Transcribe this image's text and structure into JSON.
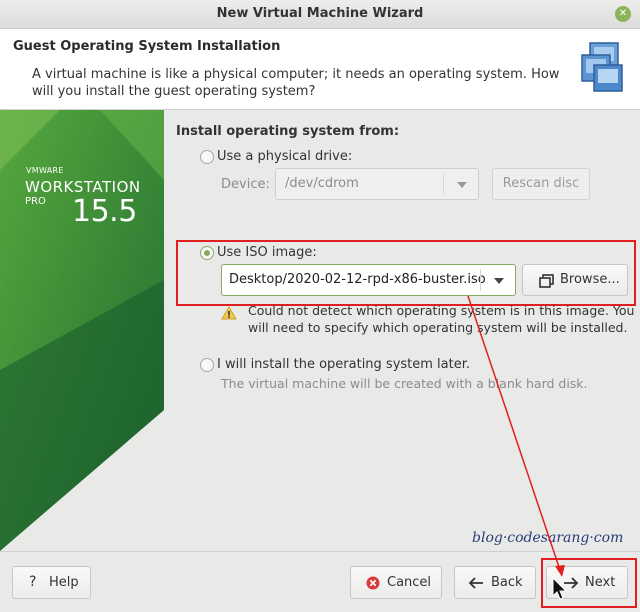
{
  "window": {
    "title": "New Virtual Machine Wizard"
  },
  "header": {
    "title": "Guest Operating System Installation",
    "description": "A virtual machine is like a physical computer; it needs an operating system. How will you install the guest operating system?"
  },
  "branding": {
    "vendor": "VMWARE",
    "product": "WORKSTATION",
    "edition": "PRO",
    "version": "15.5"
  },
  "form": {
    "section_title": "Install operating system from:",
    "physical_drive": {
      "label": "Use a physical drive:",
      "device_label": "Device:",
      "device_value": "/dev/cdrom",
      "rescan_label": "Rescan disc",
      "selected": false
    },
    "iso": {
      "label": "Use ISO image:",
      "path_value": "Desktop/2020-02-12-rpd-x86-buster.iso",
      "browse_label": "Browse...",
      "selected": true,
      "warning_line1": "Could not detect which operating system is in this image. You",
      "warning_line2": "will need to specify which operating system will be installed."
    },
    "later": {
      "label": "I will install the operating system later.",
      "hint": "The virtual machine will be created with a blank hard disk.",
      "selected": false
    }
  },
  "footer": {
    "help_label": "Help",
    "cancel_label": "Cancel",
    "back_label": "Back",
    "next_label": "Next"
  },
  "watermark": "blog·codesarang·com",
  "colors": {
    "accent_green": "#8aa865",
    "brand_green": "#3a7f2c",
    "annotation_red": "#e02020"
  },
  "icons": [
    "window-close-icon",
    "vm-stack-icon",
    "warning-icon",
    "folder-copy-icon",
    "help-icon",
    "cancel-icon",
    "back-arrow-icon",
    "next-arrow-icon",
    "dropdown-caret-icon"
  ]
}
